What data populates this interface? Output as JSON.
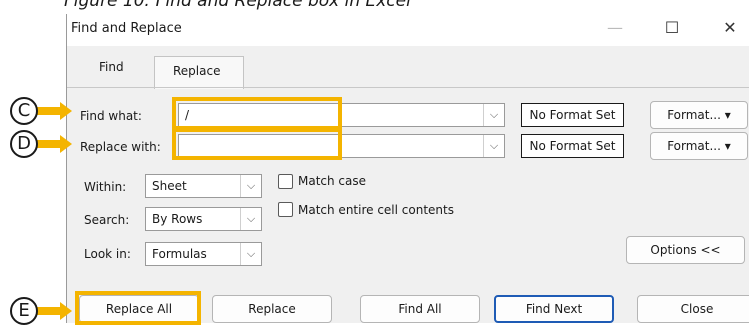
{
  "caption": "Figure 10: Find and Replace box in Excel",
  "dialog": {
    "title": "Find and Replace",
    "controls": {
      "minimize": "—",
      "maximize": "☐",
      "close": "✕"
    }
  },
  "tabs": {
    "find": "Find",
    "replace": "Replace"
  },
  "find_row": {
    "label": "Find what:",
    "value": "/",
    "format_status": "No Format Set",
    "format_button": "Format..."
  },
  "replace_row": {
    "label": "Replace with:",
    "value": "",
    "format_status": "No Format Set",
    "format_button": "Format..."
  },
  "options": {
    "within_label": "Within:",
    "within_value": "Sheet",
    "search_label": "Search:",
    "search_value": "By Rows",
    "lookin_label": "Look in:",
    "lookin_value": "Formulas",
    "match_case_label": "Match case",
    "match_case_checked": false,
    "match_entire_label": "Match entire cell contents",
    "match_entire_checked": false,
    "options_button": "Options <<"
  },
  "buttons": {
    "replace_all": "Replace All",
    "replace": "Replace",
    "find_all": "Find All",
    "find_next": "Find Next",
    "close": "Close"
  },
  "annotations": {
    "c": "C",
    "d": "D",
    "e": "E"
  },
  "colors": {
    "highlight": "#f4b400",
    "primary_border": "#1e5bb5"
  },
  "icons": {
    "chevron": "⌵",
    "dropdown": "▾"
  }
}
